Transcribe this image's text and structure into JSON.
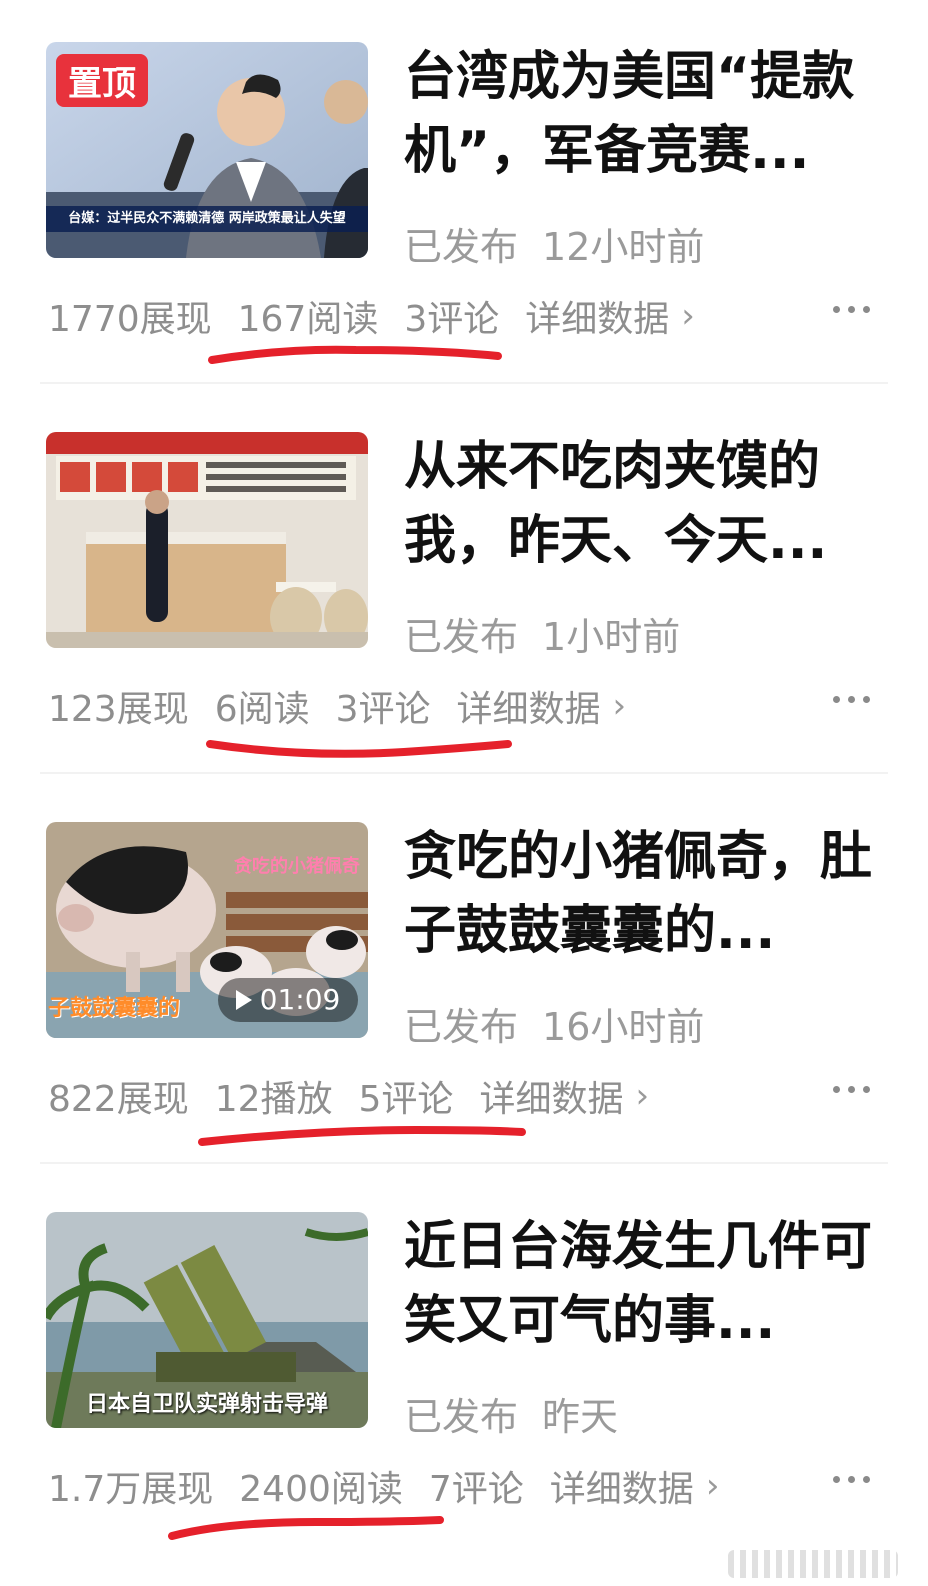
{
  "items": [
    {
      "title": "台湾成为美国“提款机”，军备竞赛...",
      "status": "已发布",
      "time": "12小时前",
      "impressions": "1770展现",
      "reads": "167阅读",
      "comments": "3评论",
      "details": "详细数据",
      "thumb_badge": "置顶",
      "thumb_caption": "台媒：过半民众不满赖清德 两岸政策最让人失望"
    },
    {
      "title": "从来不吃肉夹馍的我，昨天、今天...",
      "status": "已发布",
      "time": "1小时前",
      "impressions": "123展现",
      "reads": "6阅读",
      "comments": "3评论",
      "details": "详细数据"
    },
    {
      "title": "贪吃的小猪佩奇，肚子鼓鼓囊囊的...",
      "status": "已发布",
      "time": "16小时前",
      "impressions": "822展现",
      "reads": "12播放",
      "comments": "5评论",
      "details": "详细数据",
      "thumb_tag": "贪吃的小猪佩奇",
      "thumb_tag2": "子鼓鼓囊囊的",
      "duration": "01:09"
    },
    {
      "title": "近日台海发生几件可笑又可气的事...",
      "status": "已发布",
      "time": "昨天",
      "impressions": "1.7万展现",
      "reads": "2400阅读",
      "comments": "7评论",
      "details": "详细数据",
      "thumb_caption": "日本自卫队实弹射击导弹"
    }
  ],
  "icons": {
    "more": "more-horizontal-icon",
    "chevron": "chevron-right-icon",
    "play": "play-icon"
  },
  "colors": {
    "accent_red": "#e8323c",
    "underline_red": "#e5212b",
    "title": "#111111",
    "meta": "#8e8e8e"
  }
}
